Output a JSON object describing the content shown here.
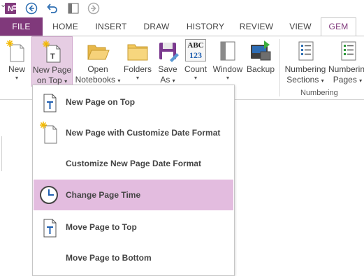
{
  "qat": {
    "more_glyph": "⌄"
  },
  "tabs": {
    "file": "FILE",
    "home": "HOME",
    "insert": "INSERT",
    "draw": "DRAW",
    "history": "HISTORY",
    "review": "REVIEW",
    "view": "VIEW",
    "gem": "GEM"
  },
  "ribbon": {
    "new": "New",
    "new_page_on_top_line1": "New Page",
    "new_page_on_top_line2": "on Top",
    "open_line1": "Open",
    "open_line2": "Notebooks",
    "folders": "Folders",
    "save_line1": "Save",
    "save_line2": "As",
    "count": "Count",
    "count_icon_top": "ABC",
    "count_icon_bottom": "123",
    "window": "Window",
    "backup": "Backup",
    "numbering_sections_line1": "Numbering",
    "numbering_sections_line2": "Sections",
    "numbering_pages_line1": "Numbering",
    "numbering_pages_line2": "Pages",
    "group_numbering": "Numbering",
    "dropdown_arrow": "▾"
  },
  "menu": {
    "items": [
      {
        "label": "New Page on Top",
        "icon": "page-t-icon"
      },
      {
        "label": "New Page with Customize Date Format",
        "icon": "new-page-icon"
      },
      {
        "label": "Customize New Page Date Format",
        "icon": ""
      },
      {
        "label": "Change Page Time",
        "icon": "clock-icon",
        "highlighted": true
      },
      {
        "label": "Move Page to Top",
        "icon": "page-t-icon"
      },
      {
        "label": "Move Page to Bottom",
        "icon": ""
      }
    ]
  },
  "colors": {
    "accent": "#80397b",
    "highlight": "#e3bcdf",
    "ribbon_active": "#e6cde3"
  }
}
